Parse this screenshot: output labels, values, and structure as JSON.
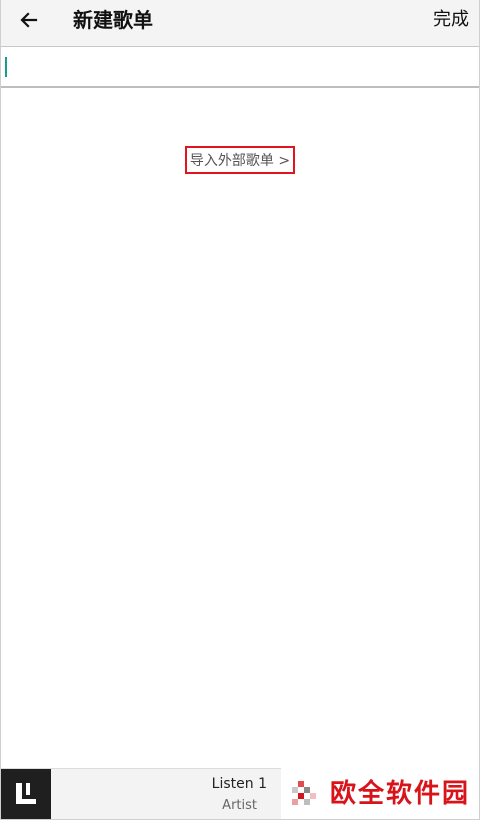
{
  "header": {
    "title": "新建歌单",
    "done_label": "完成"
  },
  "name_input": {
    "value": "",
    "placeholder": ""
  },
  "import_link": {
    "label": "导入外部歌单 >"
  },
  "player": {
    "album_icon": "listen1-logo-icon",
    "song_title": "Listen 1",
    "song_artist": "Artist"
  },
  "watermark": {
    "text": "欧全软件园"
  },
  "colors": {
    "accent_caret": "#1a9c8b",
    "highlight_box": "#e0161f",
    "watermark": "#d8141a"
  }
}
